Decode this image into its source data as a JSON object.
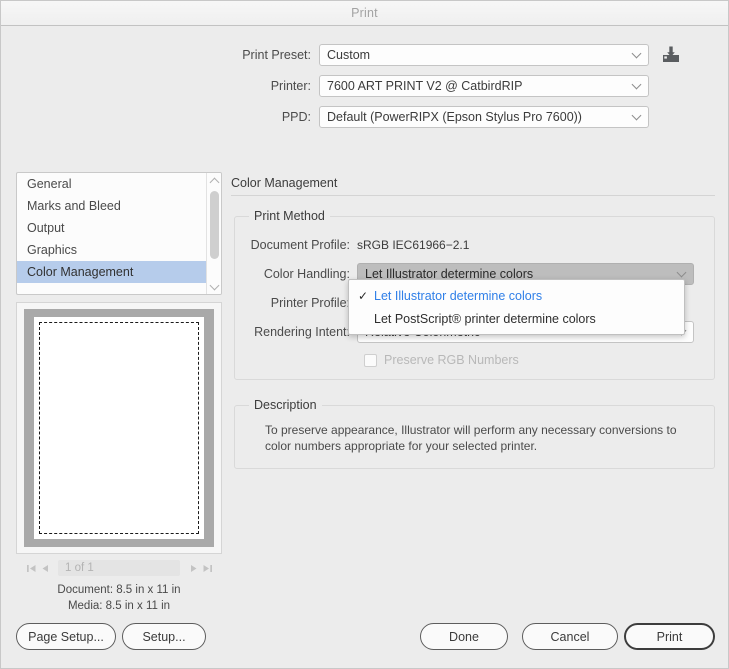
{
  "window": {
    "title": "Print"
  },
  "top_form": {
    "rows": [
      {
        "label": "Print Preset:",
        "value": "Custom"
      },
      {
        "label": "Printer:",
        "value": "7600 ART PRINT V2 @ CatbirdRIP"
      },
      {
        "label": "PPD:",
        "value": "Default (PowerRIPX (Epson Stylus Pro 7600))"
      }
    ],
    "save_preset_icon": "save-preset-icon"
  },
  "sidebar": {
    "items": [
      {
        "label": "General",
        "selected": false
      },
      {
        "label": "Marks and Bleed",
        "selected": false
      },
      {
        "label": "Output",
        "selected": false
      },
      {
        "label": "Graphics",
        "selected": false
      },
      {
        "label": "Color Management",
        "selected": true
      }
    ],
    "scroll_up_icon": "chevron-up-icon",
    "scroll_down_icon": "chevron-down-icon"
  },
  "preview": {
    "first_page_icon": "first-page-icon",
    "prev_page_icon": "previous-page-icon",
    "page_value": "1 of 1",
    "next_page_icon": "next-page-icon",
    "last_page_icon": "last-page-icon",
    "document_size": "Document: 8.5 in x 11 in",
    "media_size": "Media: 8.5 in x 11 in"
  },
  "panel": {
    "title": "Color Management",
    "print_method": {
      "legend": "Print Method",
      "document_profile_label": "Document Profile:",
      "document_profile_value": "sRGB IEC61966−2.1",
      "color_handling_label": "Color Handling:",
      "color_handling_value": "Let Illustrator determine colors",
      "printer_profile_label": "Printer Profile:",
      "printer_profile_value": "",
      "rendering_intent_label": "Rendering Intent:",
      "rendering_intent_value": "Relative Colorimetric",
      "preserve_rgb_label": "Preserve RGB Numbers",
      "preserve_rgb_checked": false,
      "preserve_rgb_enabled": false
    },
    "dropdown": {
      "open": true,
      "check_glyph": "✓",
      "options": [
        {
          "label": "Let Illustrator determine colors",
          "selected": true
        },
        {
          "label": "Let PostScript® printer determine colors",
          "selected": false
        }
      ]
    },
    "description": {
      "legend": "Description",
      "text": "To preserve appearance, Illustrator will perform any necessary conversions to color numbers appropriate for your selected printer."
    }
  },
  "footer": {
    "page_setup": "Page Setup...",
    "setup": "Setup...",
    "done": "Done",
    "cancel": "Cancel",
    "print": "Print"
  },
  "colors": {
    "selection_blue": "#b6cceb",
    "link_blue": "#2f7fe8",
    "window_bg": "#ececec",
    "open_select_gray": "#bdbdbd"
  }
}
